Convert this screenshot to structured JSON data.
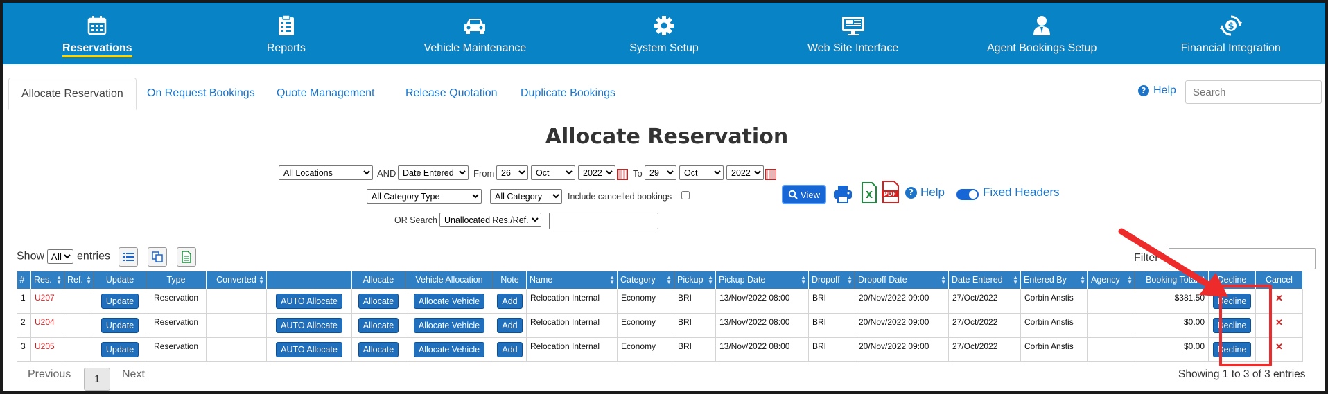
{
  "nav": {
    "items": [
      {
        "label": "Reservations",
        "icon": "calendar-icon"
      },
      {
        "label": "Reports",
        "icon": "checklist-icon"
      },
      {
        "label": "Vehicle Maintenance",
        "icon": "car-icon"
      },
      {
        "label": "System Setup",
        "icon": "gear-icon"
      },
      {
        "label": "Web Site Interface",
        "icon": "monitor-icon"
      },
      {
        "label": "Agent Bookings Setup",
        "icon": "agent-icon"
      },
      {
        "label": "Financial Integration",
        "icon": "dollar-cycle-icon"
      }
    ],
    "active": "Reservations"
  },
  "tabs": [
    "Allocate Reservation",
    "On Request Bookings",
    "Quote Management",
    "Release Quotation",
    "Duplicate Bookings"
  ],
  "help_label": "Help",
  "search_placeholder": "Search",
  "page_title": "Allocate Reservation",
  "filters": {
    "location": "All Locations",
    "and_label": "AND",
    "date_type": "Date Entered",
    "from_label": "From",
    "from_day": "26",
    "from_month": "Oct",
    "from_year": "2022",
    "to_label": "To",
    "to_day": "29",
    "to_month": "Oct",
    "to_year": "2022",
    "category_type": "All Category Type",
    "category": "All Category",
    "include_cancelled_label": "Include cancelled bookings",
    "or_search_label": "OR Search",
    "search_type": "Unallocated Res./Ref.",
    "view_label": "View",
    "help_label": "Help",
    "fixed_headers_label": "Fixed Headers"
  },
  "table_controls": {
    "show_label": "Show",
    "entries_value": "All",
    "entries_label": "entries",
    "filter_label": "Filter"
  },
  "table": {
    "headers": [
      "#",
      "Res.",
      "Ref.",
      "Update",
      "Type",
      "Converted",
      "",
      "Allocate",
      "Vehicle Allocation",
      "Note",
      "Name",
      "Category",
      "Pickup",
      "Pickup Date",
      "Dropoff",
      "Dropoff Date",
      "Date Entered",
      "Entered By",
      "Agency",
      "Booking Total",
      "Decline",
      "Cancel"
    ],
    "rows": [
      {
        "num": "1",
        "res": "U207",
        "ref": "",
        "update": "Update",
        "type": "Reservation",
        "converted": "",
        "auto": "AUTO Allocate",
        "allocate": "Allocate",
        "vehicle_alloc": "Allocate Vehicle",
        "note": "Add",
        "name": "Relocation Internal",
        "category": "Economy",
        "pickup": "BRI",
        "pickup_date": "13/Nov/2022 08:00",
        "dropoff": "BRI",
        "dropoff_date": "20/Nov/2022 09:00",
        "date_entered": "27/Oct/2022",
        "entered_by": "Corbin Anstis",
        "agency": "",
        "total": "$381.50",
        "decline": "Decline",
        "cancel": "✕"
      },
      {
        "num": "2",
        "res": "U204",
        "ref": "",
        "update": "Update",
        "type": "Reservation",
        "converted": "",
        "auto": "AUTO Allocate",
        "allocate": "Allocate",
        "vehicle_alloc": "Allocate Vehicle",
        "note": "Add",
        "name": "Relocation Internal",
        "category": "Economy",
        "pickup": "BRI",
        "pickup_date": "13/Nov/2022 08:00",
        "dropoff": "BRI",
        "dropoff_date": "20/Nov/2022 09:00",
        "date_entered": "27/Oct/2022",
        "entered_by": "Corbin Anstis",
        "agency": "",
        "total": "$0.00",
        "decline": "Decline",
        "cancel": "✕"
      },
      {
        "num": "3",
        "res": "U205",
        "ref": "",
        "update": "Update",
        "type": "Reservation",
        "converted": "",
        "auto": "AUTO Allocate",
        "allocate": "Allocate",
        "vehicle_alloc": "Allocate Vehicle",
        "note": "Add",
        "name": "Relocation Internal",
        "category": "Economy",
        "pickup": "BRI",
        "pickup_date": "13/Nov/2022 08:00",
        "dropoff": "BRI",
        "dropoff_date": "20/Nov/2022 09:00",
        "date_entered": "27/Oct/2022",
        "entered_by": "Corbin Anstis",
        "agency": "",
        "total": "$0.00",
        "decline": "Decline",
        "cancel": "✕"
      }
    ]
  },
  "pager": {
    "previous": "Previous",
    "page": "1",
    "next": "Next",
    "showing": "Showing 1 to 3 of 3 entries"
  },
  "colors": {
    "nav_bg": "#0783c6",
    "table_header": "#2f7fc4",
    "button": "#1f6fbd",
    "link": "#1b74c9",
    "annotation": "#ee2b2b"
  }
}
